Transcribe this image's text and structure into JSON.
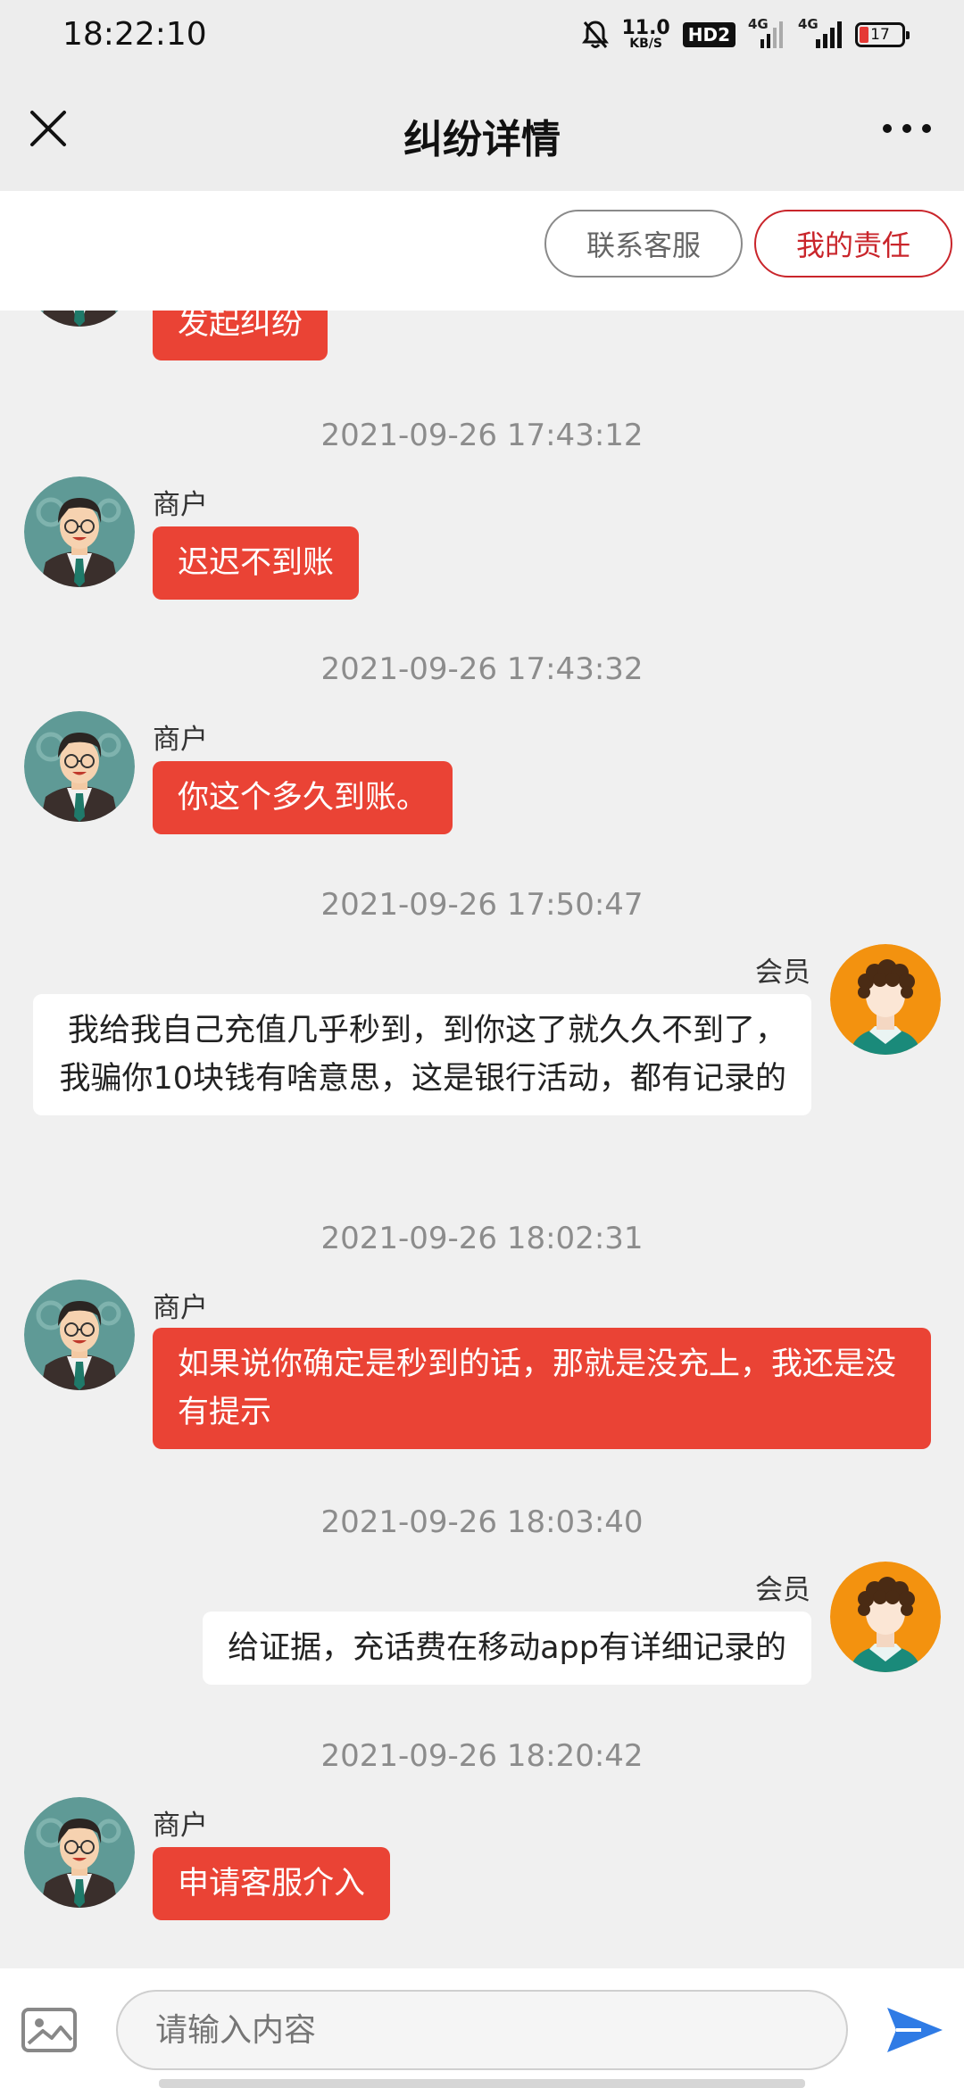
{
  "status_bar": {
    "time": "18:22:10",
    "speed_value": "11.0",
    "speed_unit": "KB/S",
    "hd_badge": "HD2",
    "network1": "4G",
    "network2": "4G",
    "battery": "17"
  },
  "header": {
    "title": "纠纷详情"
  },
  "actions": {
    "contact_service": "联系客服",
    "my_responsibility": "我的责任"
  },
  "messages": [
    {
      "sender": "",
      "text": "发起纠纷"
    },
    {
      "time": "2021-09-26 17:43:12",
      "sender": "商户",
      "text": "迟迟不到账"
    },
    {
      "time": "2021-09-26 17:43:32",
      "sender": "商户",
      "text": "你这个多久到账。"
    },
    {
      "time": "2021-09-26 17:50:47",
      "sender": "会员",
      "text": "我给我自己充值几乎秒到，到你这了就久久不到了，我骗你10块钱有啥意思，这是银行活动，都有记录的"
    },
    {
      "time": "2021-09-26 18:02:31",
      "sender": "商户",
      "text": "如果说你确定是秒到的话，那就是没充上，我还是没有提示"
    },
    {
      "time": "2021-09-26 18:03:40",
      "sender": "会员",
      "text": "给证据，充话费在移动app有详细记录的"
    },
    {
      "time": "2021-09-26 18:20:42",
      "sender": "商户",
      "text": "申请客服介入"
    }
  ],
  "composer": {
    "placeholder": "请输入内容"
  },
  "colors": {
    "accent_red": "#ea4335",
    "outline_red": "#c9252b",
    "send_blue": "#2f7be5"
  }
}
